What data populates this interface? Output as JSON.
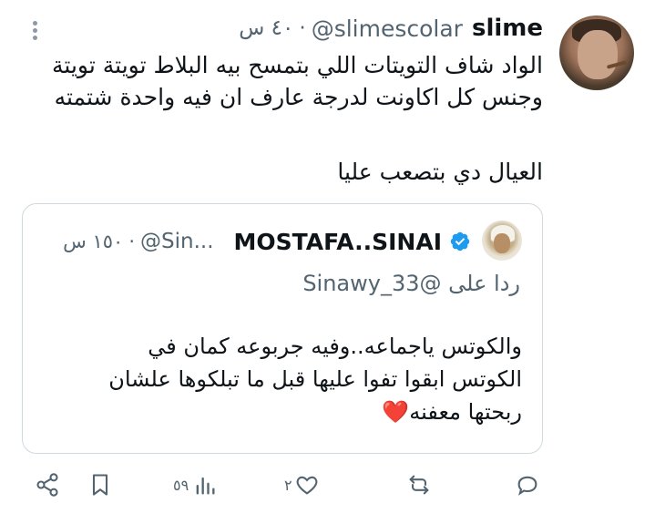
{
  "tweet": {
    "name": "slime",
    "handle": "@slimescolar",
    "separator": "·",
    "time": "٤٠ س",
    "text_lines": [
      "الواد شاف التويتات اللي بتمسح بيه البلاط تويتة تويتة",
      "وجنس كل اكاونت لدرجة عارف ان فيه واحدة شتمته",
      "",
      "العيال دي بتصعب عليا"
    ]
  },
  "quote": {
    "name": "MOSTAFA..SINAI",
    "handle": "@Sin...",
    "separator": "·",
    "time": "١٥٠ س",
    "reply_prefix": "ردا على",
    "reply_to": "@Sinawy_33",
    "text_lines": [
      "والكوتس ياجماعه..وفيه جربوعه كمان في",
      "الكوتس ابقوا تفوا عليها قبل ما تبلكوها علشان",
      "ربحتها معفنه❤️"
    ]
  },
  "actions": {
    "reply_count": "",
    "retweet_count": "",
    "like_count": "٢",
    "views_count": "٥٩"
  },
  "colors": {
    "text": "#0f1419",
    "muted": "#536471",
    "verified": "#1d9bf0",
    "border": "#cfd9de"
  }
}
